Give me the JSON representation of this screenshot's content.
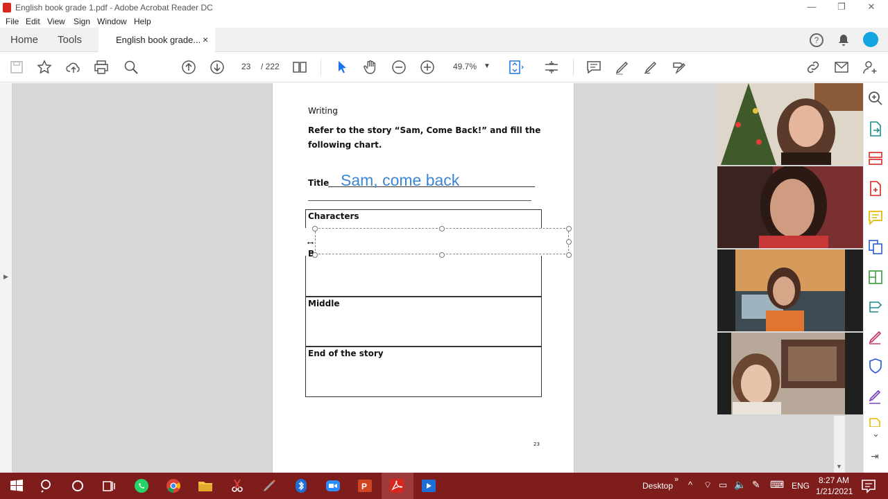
{
  "window": {
    "title": "English book grade 1.pdf - Adobe Acrobat Reader DC"
  },
  "menu": [
    "File",
    "Edit",
    "View",
    "Sign",
    "Window",
    "Help"
  ],
  "tabs": {
    "home": "Home",
    "tools": "Tools",
    "document": "English book grade...",
    "close": "×"
  },
  "toolbar": {
    "page_current": "23",
    "page_total": "/ 222",
    "zoom": "49.7%"
  },
  "document": {
    "heading": "Writing",
    "instruction_line1": "Refer to the story “Sam, Come Back!” and fill the",
    "instruction_line2": "following chart.",
    "title_label": "Title",
    "title_value": "Sam, come back",
    "characters_label": "Characters",
    "beginning_label_partial": "B",
    "middle_label": "Middle",
    "end_label": "End of the story",
    "page_number": "23"
  },
  "taskbar": {
    "desktop_label": "Desktop",
    "language": "ENG",
    "time": "8:27 AM",
    "date": "1/21/2021"
  },
  "colors": {
    "accent_blue": "#1a73e8",
    "title_ink": "#3a86d6",
    "taskbar": "#7f1c1c",
    "acrobat_red": "#d6281f"
  }
}
